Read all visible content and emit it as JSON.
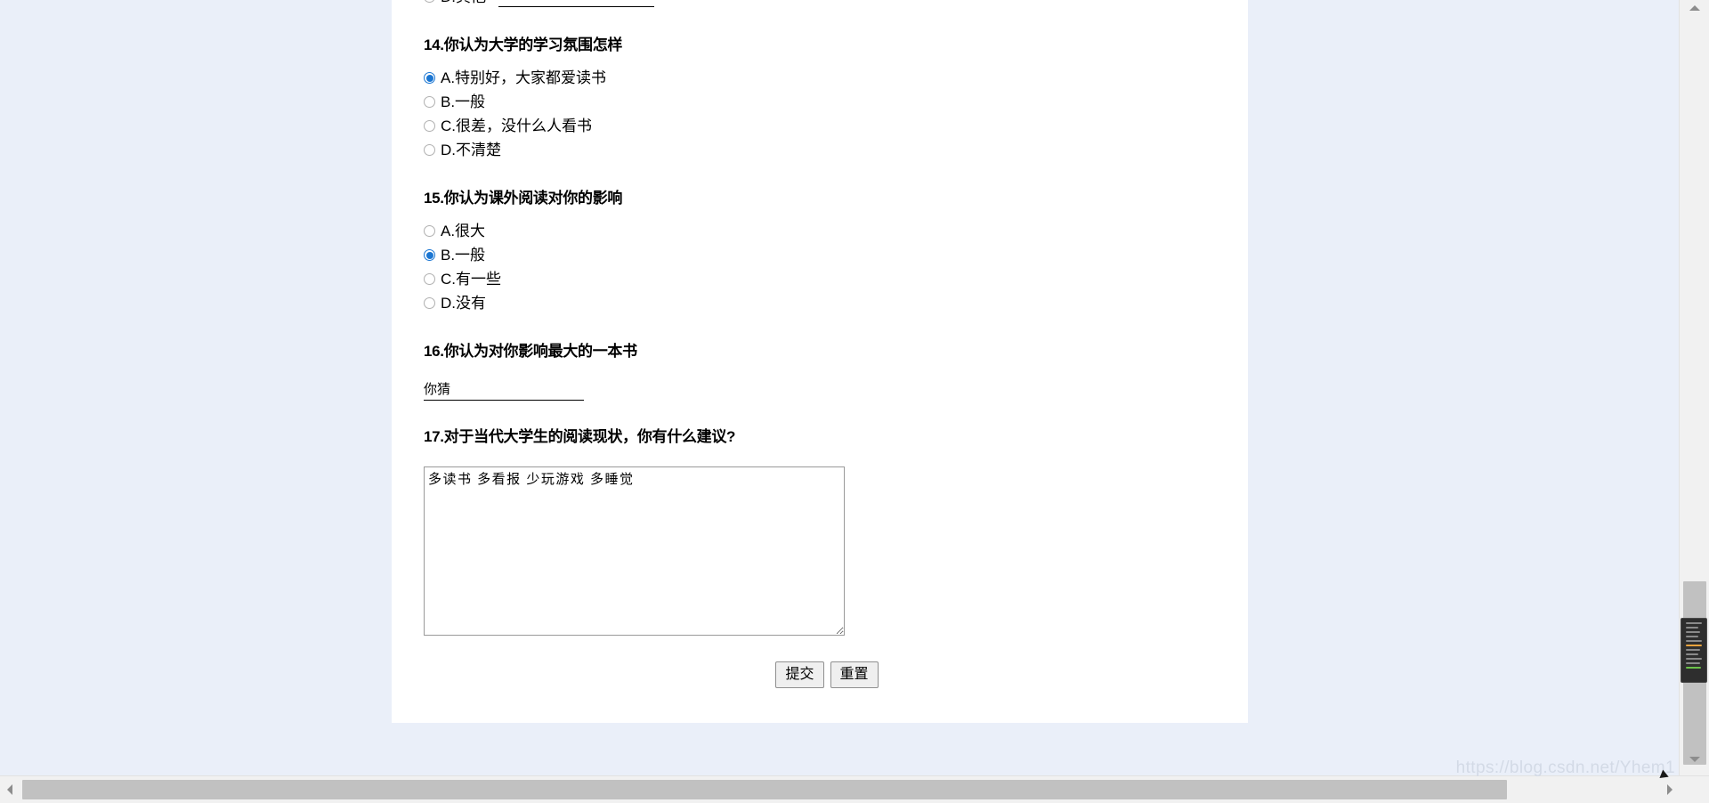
{
  "page": {
    "background_color": "#eaeff9",
    "card_color": "#ffffff",
    "accent_color": "#1b76d2",
    "watermark": "https://blog.csdn.net/Yhem1"
  },
  "clipped_top_question": {
    "option_label": "D.其他",
    "input_value": "",
    "input_placeholder": ""
  },
  "questions": [
    {
      "id": "q14",
      "title": "14.你认为大学的学习氛围怎样",
      "type": "radio",
      "options": [
        {
          "label": "A.特别好，大家都爱读书",
          "checked": true
        },
        {
          "label": "B.一般",
          "checked": false
        },
        {
          "label": "C.很差，没什么人看书",
          "checked": false
        },
        {
          "label": "D.不清楚",
          "checked": false
        }
      ]
    },
    {
      "id": "q15",
      "title": "15.你认为课外阅读对你的影响",
      "type": "radio",
      "options": [
        {
          "label": "A.很大",
          "checked": false
        },
        {
          "label": "B.一般",
          "checked": true
        },
        {
          "label": "C.有一些",
          "checked": false
        },
        {
          "label": "D.没有",
          "checked": false
        }
      ]
    },
    {
      "id": "q16",
      "title": "16.你认为对你影响最大的一本书",
      "type": "text",
      "value": "你猜",
      "placeholder": ""
    },
    {
      "id": "q17",
      "title": "17.对于当代大学生的阅读现状，你有什么建议?",
      "type": "textarea",
      "value": "多读书 多看报 少玩游戏 多睡觉",
      "placeholder": ""
    }
  ],
  "buttons": {
    "submit_label": "提交",
    "reset_label": "重置"
  },
  "scrollbars": {
    "vertical_position_percent": 78,
    "horizontal_position_percent": 0
  }
}
